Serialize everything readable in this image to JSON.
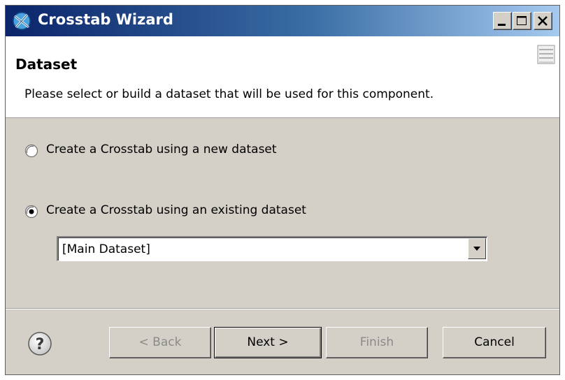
{
  "window": {
    "title": "Crosstab Wizard",
    "title_bar_colors": [
      "#0b246a",
      "#a6caf0"
    ],
    "controls": {
      "minimize_icon": "minimize-icon",
      "maximize_icon": "maximize-icon",
      "close_icon": "close-icon"
    }
  },
  "header": {
    "title": "Dataset",
    "description": "Please select or build a dataset that will be used for this component.",
    "icon": "wizard-banner-icon"
  },
  "options": {
    "new_dataset": {
      "label": "Create a Crosstab using a new dataset",
      "selected": false
    },
    "existing_dataset": {
      "label": "Create a Crosstab using an existing dataset",
      "selected": true
    }
  },
  "dataset_select": {
    "value": "[Main Dataset]"
  },
  "footer": {
    "help_icon": "help-icon",
    "back_label": "< Back",
    "back_enabled": false,
    "next_label": "Next >",
    "next_enabled": true,
    "finish_label": "Finish",
    "finish_enabled": false,
    "cancel_label": "Cancel",
    "cancel_enabled": true
  }
}
